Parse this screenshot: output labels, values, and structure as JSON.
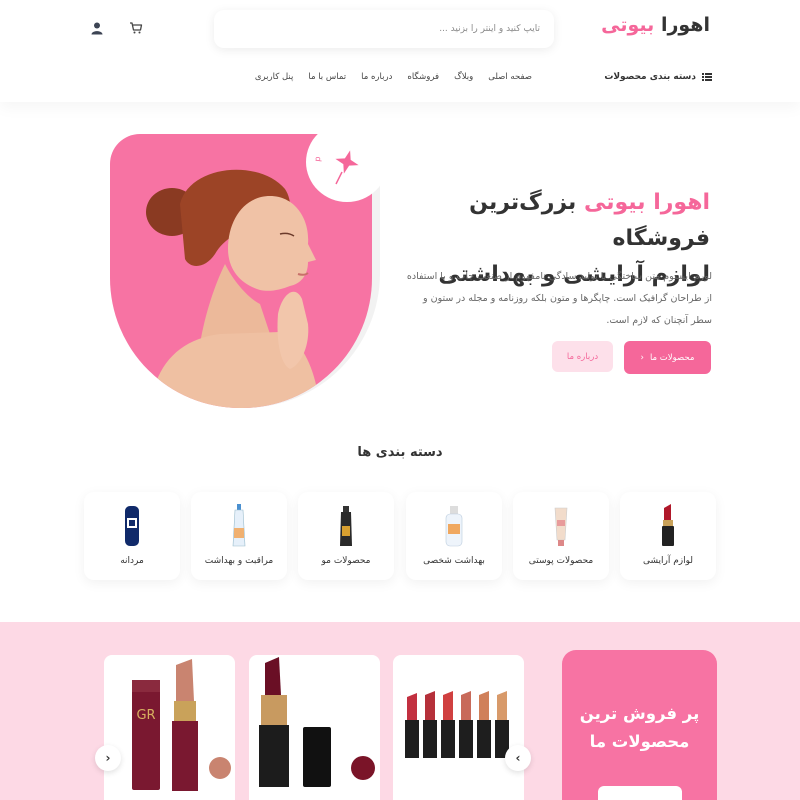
{
  "header": {
    "logo_main": "اهورا ",
    "logo_accent": "بیوتی",
    "search_placeholder": "تایپ کنید و اینتر را بزنید ...",
    "category_menu": "دسته بندی محصولات",
    "nav": [
      "صفحه اصلی",
      "وبلاگ",
      "فروشگاه",
      "درباره ما",
      "تماس با ما",
      "پنل کاربری"
    ]
  },
  "hero": {
    "title_accent": "اهورا بیوتی",
    "title_rest": " بزرگ‌ترین فروشگاه",
    "title_line2": "لوازم آرایشی و بهداشتی",
    "text": "لورم ایپسوم متن ساختگی با تولید سادگی نامفهوم از صنعت چاپ و با استفاده از طراحان گرافیک است. چاپگرها و متون بلکه روزنامه و مجله در ستون و سطر آنچنان که لازم است.",
    "btn_products": "محصولات ما",
    "btn_about": "درباره ما",
    "badge_text": "Beauty Shop"
  },
  "categories": {
    "title": "دسته بندی ها",
    "items": [
      {
        "label": "لوازم آرایشی",
        "icon": "lipstick-icon"
      },
      {
        "label": "محصولات پوستی",
        "icon": "skincare-tube-icon"
      },
      {
        "label": "بهداشت شخصی",
        "icon": "hygiene-bottle-icon"
      },
      {
        "label": "محصولات مو",
        "icon": "hair-product-icon"
      },
      {
        "label": "مراقبت و بهداشت",
        "icon": "care-bottle-icon"
      },
      {
        "label": "مردانه",
        "icon": "deodorant-icon"
      }
    ]
  },
  "best_sellers": {
    "title_line1": "پر فروش ترین",
    "title_line2": "محصولات ما"
  },
  "colors": {
    "accent": "#f5679a",
    "hero_pink": "#f773a3",
    "section_pink": "#fdd9e5"
  }
}
